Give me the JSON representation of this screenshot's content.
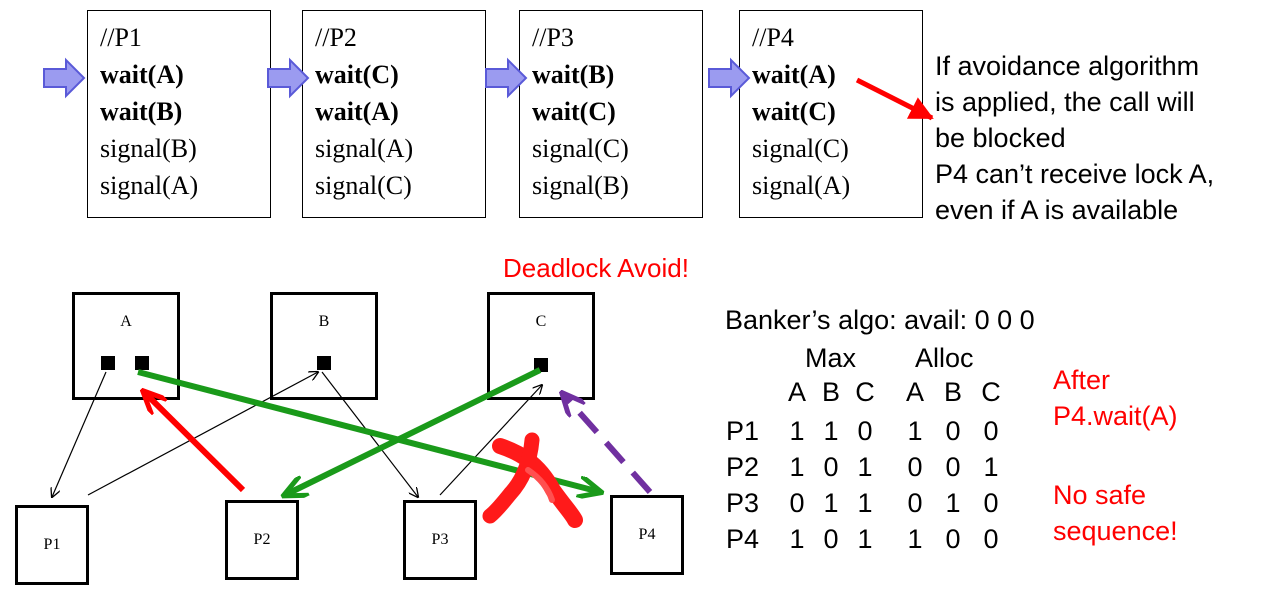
{
  "processes": [
    {
      "header": "//P1",
      "lines": [
        {
          "text": "wait(A)",
          "bold": true
        },
        {
          "text": "wait(B)",
          "bold": true
        },
        {
          "text": "signal(B)",
          "bold": false
        },
        {
          "text": "signal(A)",
          "bold": false
        }
      ]
    },
    {
      "header": "//P2",
      "lines": [
        {
          "text": "wait(C)",
          "bold": true
        },
        {
          "text": "wait(A)",
          "bold": true
        },
        {
          "text": "signal(A)",
          "bold": false
        },
        {
          "text": "signal(C)",
          "bold": false
        }
      ]
    },
    {
      "header": "//P3",
      "lines": [
        {
          "text": "wait(B)",
          "bold": true
        },
        {
          "text": "wait(C)",
          "bold": true
        },
        {
          "text": "signal(C)",
          "bold": false
        },
        {
          "text": "signal(B)",
          "bold": false
        }
      ]
    },
    {
      "header": "//P4",
      "lines": [
        {
          "text": "wait(A)",
          "bold": true
        },
        {
          "text": "wait(C)",
          "bold": true
        },
        {
          "text": "signal(C)",
          "bold": false
        },
        {
          "text": "signal(A)",
          "bold": false
        }
      ]
    }
  ],
  "note_lines": [
    "If avoidance algorithm",
    "is applied, the call will",
    "be blocked",
    "P4 can’t receive lock A,",
    "even if A is available"
  ],
  "title_red": "Deadlock Avoid!",
  "resources": [
    "A",
    "B",
    "C"
  ],
  "process_nodes": [
    "P1",
    "P2",
    "P3",
    "P4"
  ],
  "bankers": {
    "title": "Banker’s algo:  avail: 0 0 0",
    "max_header": "Max",
    "alloc_header": "Alloc",
    "columns": [
      "A",
      "B",
      "C",
      "A",
      "B",
      "C"
    ],
    "rows": [
      {
        "name": "P1",
        "values": [
          "1",
          "1",
          "0",
          "1",
          "0",
          "0"
        ]
      },
      {
        "name": "P2",
        "values": [
          "1",
          "0",
          "1",
          "0",
          "0",
          "1"
        ]
      },
      {
        "name": "P3",
        "values": [
          "0",
          "1",
          "1",
          "0",
          "1",
          "0"
        ]
      },
      {
        "name": "P4",
        "values": [
          "1",
          "0",
          "1",
          "1",
          "0",
          "0"
        ]
      }
    ]
  },
  "side_notes": {
    "after": [
      "After",
      "P4.wait(A)"
    ],
    "no_safe": [
      "No safe",
      "sequence!"
    ]
  },
  "colors": {
    "red": "#ff0000",
    "green": "#1a9a1a",
    "purple": "#7030a0",
    "arrow_fill": "#9b9bf0",
    "arrow_stroke": "#5a5ad8"
  }
}
